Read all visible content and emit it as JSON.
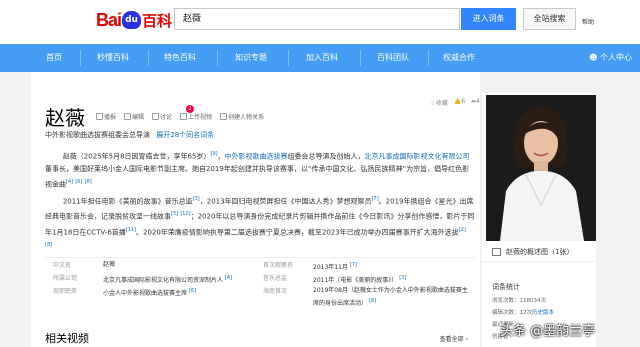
{
  "header": {
    "logo_bai": "Bai",
    "logo_du": "du",
    "logo_baike": "百科",
    "search_value": "赵薇",
    "enter_btn": "进入词条",
    "global_btn": "全站搜索",
    "help": "帮助"
  },
  "nav": {
    "items": [
      "首页",
      "秒懂百科",
      "特色百科",
      "知识专题",
      "加入百科",
      "百科团队",
      "权威合作"
    ],
    "user": "个人中心"
  },
  "entry": {
    "title": "赵薇",
    "tools": [
      "播报",
      "编辑",
      "讨论",
      "上传视频",
      "创建人物关系"
    ],
    "discuss_badge": "2",
    "favorite": "收藏",
    "like_count": "6",
    "share_count": "4",
    "subtitle": "中外影视歌曲选拔赛组委会总导演",
    "subtitle_more": "展开28个同名词条"
  },
  "para1": {
    "t1": "赵薇（2025年5月8日因胃癌去世，享年65岁）",
    "s1": "[9]",
    "t2": "，",
    "l1": "中外影视歌曲选拔赛",
    "t3": "组委会总导演及创始人，",
    "l2": "北京凡事成国际影视文化有限公司",
    "t4": "董事长，美国好莱坞小金人国际电影节副主席。她自2019年起创建并执导该赛事，以“传承中国文化、弘扬民族精神”为宗旨，倡导红色影视金曲",
    "s2": "[4]",
    "s3": "[6]",
    "s4": "[8]"
  },
  "para2": {
    "t1": "2011年担任电影《美丽的故事》音乐总监",
    "s1": "[3]",
    "t2": "，2013年回归电视荧屏担任《中国达人秀》梦想观察员",
    "s2": "[7]",
    "t3": "。2019年携组合《星光》出席经典电影音乐会，记录脱贫攻坚一线故事",
    "s3": "[5]",
    "s4": "[10]",
    "t4": "；2020年以总导演身份完成纪录片剪辑并携作品前往《今日影讯》分享创作感悟，影片于同年1月18日在CCTV-6首播",
    "s5": "[11]",
    "t5": "。2020年荣膺疫情影响执导第二届选拔赛宁夏总决赛，截至2023年已成功举办四届赛事开扩大海外选拔",
    "s6": "[2]",
    "s7": "[8]"
  },
  "infobox": {
    "rows": [
      {
        "k1": "中文名",
        "v1": "赵薇",
        "k2": "首次观察员",
        "v2": "2013年11月",
        "s2": "[7]"
      },
      {
        "k1": "所属公司",
        "v1": "北京凡事成国际影视文化有限公司资深制片人",
        "s1": "[4]",
        "k2": "音乐总监",
        "v2": "2011年（电影《美丽的故事》）",
        "s2": "[3]"
      },
      {
        "k1": "现职职务",
        "v1": "小金人中外影视歌曲选拔赛主席",
        "s1": "[6]",
        "k2": "海南首次",
        "v2": "2019年08月（赵薇女士作为小金人中外影视歌曲选拔赛主席的身份出席活动）",
        "s2": "[8]"
      }
    ]
  },
  "related": {
    "title": "相关视频",
    "see_all": "查看全部"
  },
  "sidebar": {
    "photo_caption": "赵薇的概述图（1张）",
    "stats_title": "词条统计",
    "views": "浏览次数：118034次",
    "edits_prefix": "编辑次数：12次",
    "edits_link": "历史版本",
    "last_update": "最近更新：",
    "creator": "创建者："
  },
  "watermark": "头条 @墨韵兰亭",
  "colors": {
    "brand_red": "#e10601",
    "nav_blue": "#459df5",
    "button_blue": "#3385ff",
    "link_blue": "#136ec2"
  }
}
